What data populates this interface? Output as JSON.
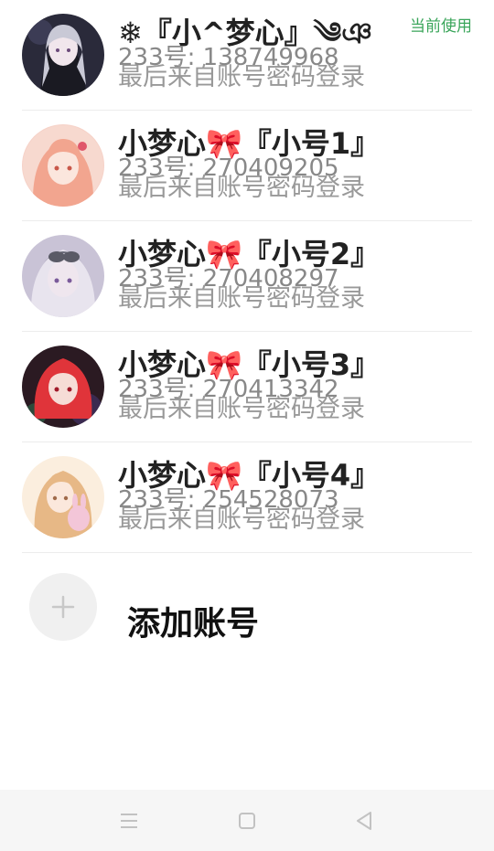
{
  "accounts": [
    {
      "name": "❄『小^梦心』༄ঞ",
      "id_text": "233号: 138749968",
      "login_text": "最后来自账号密码登录",
      "badge": "当前使用",
      "avatar_icon": "avatar-dark-hair-girl",
      "avatar_colors": {
        "bg": "#2a2a3a",
        "hair": "#c9c9d6",
        "skin": "#f1e6ec"
      }
    },
    {
      "name": "小梦心🎀『小号1』",
      "id_text": "233号: 270409205",
      "login_text": "最后来自账号密码登录",
      "avatar_icon": "avatar-pink-hair-girl",
      "avatar_colors": {
        "bg": "#f6d2c8",
        "hair": "#f2a58f",
        "skin": "#fbe6dd"
      }
    },
    {
      "name": "小梦心🎀『小号2』",
      "id_text": "233号: 270408297",
      "login_text": "最后来自账号密码登录",
      "avatar_icon": "avatar-silver-hair-girl",
      "avatar_colors": {
        "bg": "#c9c3d6",
        "hair": "#e8e4ee",
        "skin": "#efe6ee"
      }
    },
    {
      "name": "小梦心🎀『小号3』",
      "id_text": "233号: 270413342",
      "login_text": "最后来自账号密码登录",
      "avatar_icon": "avatar-red-hair-girl",
      "avatar_colors": {
        "bg": "#2b1a22",
        "hair": "#e0343a",
        "skin": "#f6dcd6"
      }
    },
    {
      "name": "小梦心🎀『小号4』",
      "id_text": "233号: 254528073",
      "login_text": "最后来自账号密码登录",
      "avatar_icon": "avatar-blonde-girl-bunny",
      "avatar_colors": {
        "bg": "#fbeede",
        "hair": "#e7b886",
        "skin": "#fbe8dc"
      }
    }
  ],
  "add_account": {
    "label": "添加账号",
    "icon": "plus-icon"
  },
  "colors": {
    "badge": "#3aa55a",
    "name": "#222222",
    "secondary": "#999999"
  },
  "nav": {
    "menu_icon": "menu-icon",
    "home_icon": "home-square-icon",
    "back_icon": "back-triangle-icon"
  }
}
